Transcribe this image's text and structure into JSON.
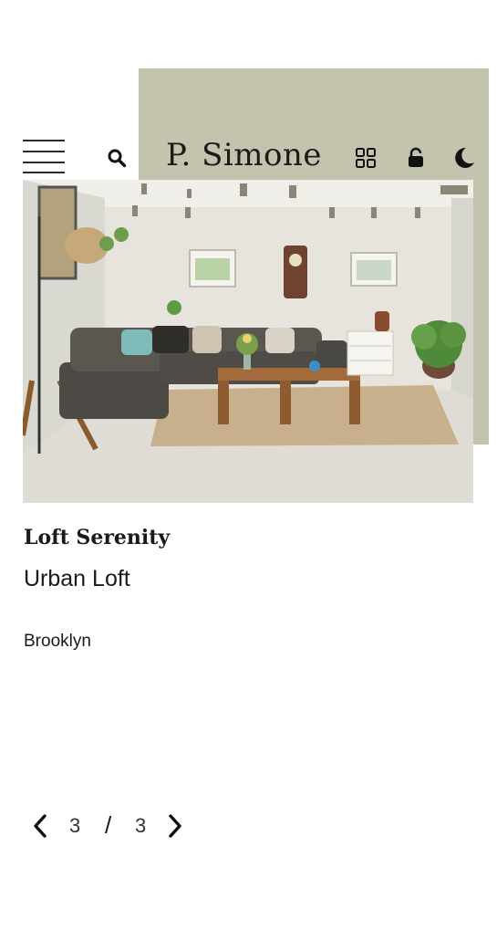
{
  "colors": {
    "accent_panel": "#c4c3ae",
    "text": "#1a1a1a"
  },
  "header": {
    "brand": "P. Simone",
    "icons": [
      "hamburger-menu-icon",
      "search-icon",
      "grid-view-icon",
      "lock-icon",
      "dark-mode-moon-icon"
    ]
  },
  "listing": {
    "image_alt": "Living room with grey sectional sofa and wooden coffee table",
    "title": "Loft Serenity",
    "subtitle": "Urban Loft",
    "location": "Brooklyn"
  },
  "pager": {
    "current": "3",
    "separator": "/",
    "total": "3"
  }
}
